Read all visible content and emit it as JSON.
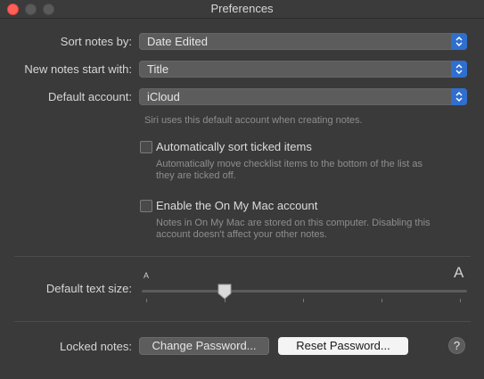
{
  "window": {
    "title": "Preferences"
  },
  "sort_notes": {
    "label": "Sort notes by:",
    "value": "Date Edited"
  },
  "new_notes": {
    "label": "New notes start with:",
    "value": "Title"
  },
  "default_account": {
    "label": "Default account:",
    "value": "iCloud",
    "hint": "Siri uses this default account when creating notes."
  },
  "auto_sort": {
    "label": "Automatically sort ticked items",
    "checked": false,
    "hint_line1": "Automatically move checklist items to the bottom of the list as",
    "hint_line2": "they are ticked off."
  },
  "on_my_mac": {
    "label": "Enable the On My Mac account",
    "checked": false,
    "hint_line1": "Notes in On My Mac are stored on this computer. Disabling this",
    "hint_line2": "account doesn't affect your other notes."
  },
  "text_size": {
    "label": "Default text size:",
    "small_glyph": "A",
    "large_glyph": "A",
    "level_step": 2,
    "steps": 5
  },
  "locked_notes": {
    "label": "Locked notes:",
    "change_password": "Change Password...",
    "reset_password": "Reset Password...",
    "help": "?"
  },
  "colors": {
    "accent": "#2f6fcf",
    "background": "#3a3a3a"
  },
  "icons": [
    "close-icon",
    "minimize-icon",
    "zoom-icon",
    "stepper-icon",
    "slider-thumb-icon",
    "help-icon"
  ]
}
